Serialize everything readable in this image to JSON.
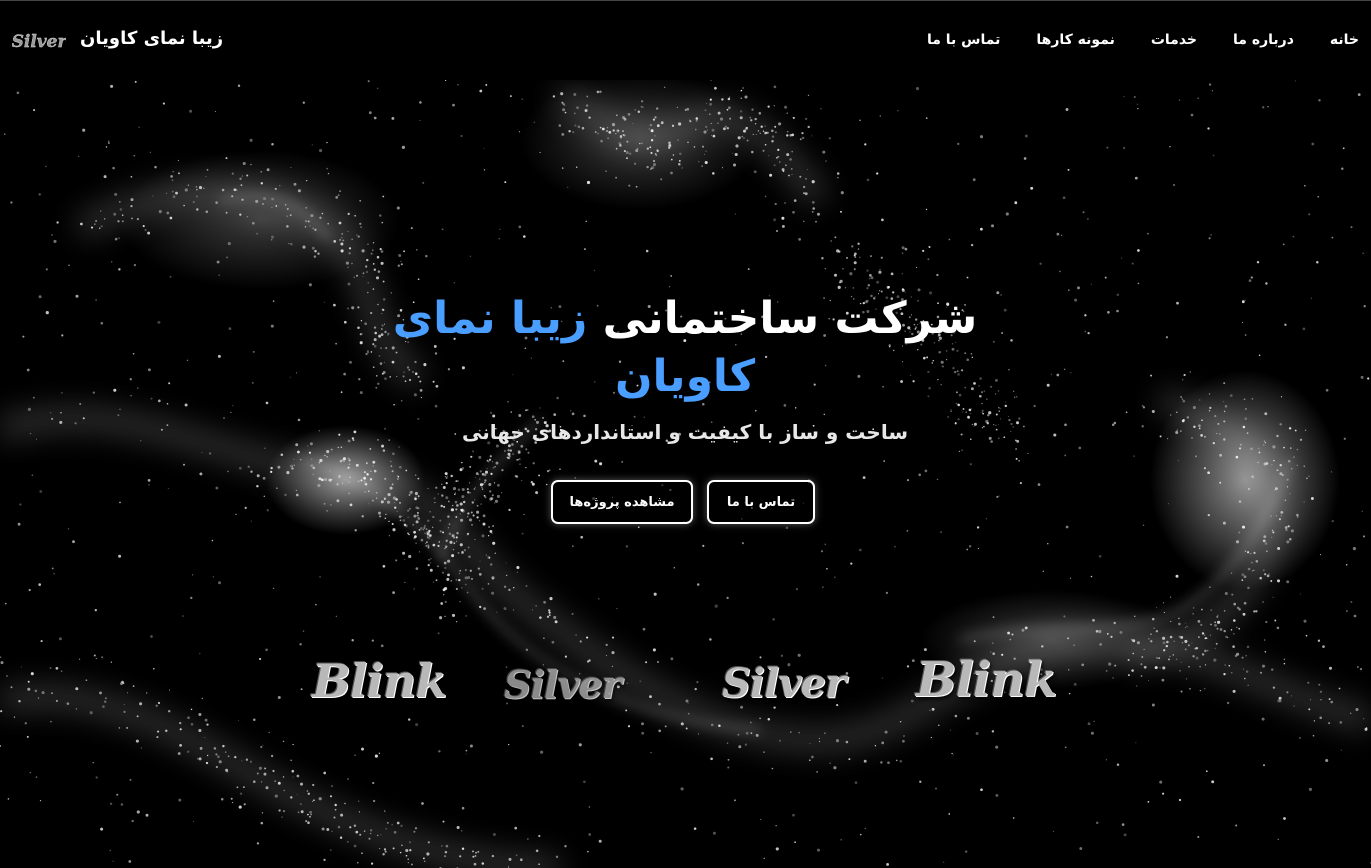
{
  "brand": {
    "name": "زیبا نمای کاویان",
    "logo_text": "Silver"
  },
  "nav": {
    "items": [
      {
        "label": "خانه"
      },
      {
        "label": "درباره ما"
      },
      {
        "label": "خدمات"
      },
      {
        "label": "نمونه کارها"
      },
      {
        "label": "تماس با ما"
      }
    ]
  },
  "hero": {
    "title_plain": "شرکت ساختمانی ",
    "title_accent": "زیبا نمای کاویان",
    "subtitle": "ساخت و ساز با کیفیت و استانداردهای جهانی",
    "contact_button": "تماس با ما",
    "projects_button": "مشاهده پروژه‌ها"
  },
  "brand_strip": [
    "Blink",
    "Silver",
    "Silver",
    "Blink"
  ],
  "colors": {
    "background": "#000000",
    "accent": "#4a9eff",
    "text": "#ffffff"
  }
}
